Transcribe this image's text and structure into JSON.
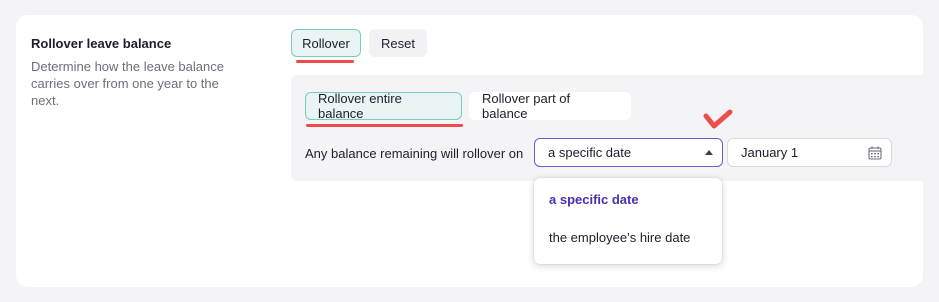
{
  "section": {
    "title": "Rollover leave balance",
    "description": "Determine how the leave balance carries over from one year to the next."
  },
  "top_buttons": {
    "rollover": "Rollover",
    "reset": "Reset"
  },
  "balance_buttons": {
    "entire": "Rollover entire balance",
    "part": "Rollover part of balance"
  },
  "rollover_on": {
    "label": "Any balance remaining will rollover on",
    "selected": "a specific date",
    "date_value": "January 1"
  },
  "dropdown": {
    "options": [
      "a specific date",
      "the employee’s hire date"
    ]
  },
  "colors": {
    "annotation": "#ef4b4b",
    "selected_option": "#4a2fb0",
    "select_border": "#6d5bd0",
    "selected_button_border": "#7dc8c0"
  },
  "icons": [
    "chevron-up-icon",
    "calendar-icon",
    "checkmark-annotation-icon"
  ]
}
